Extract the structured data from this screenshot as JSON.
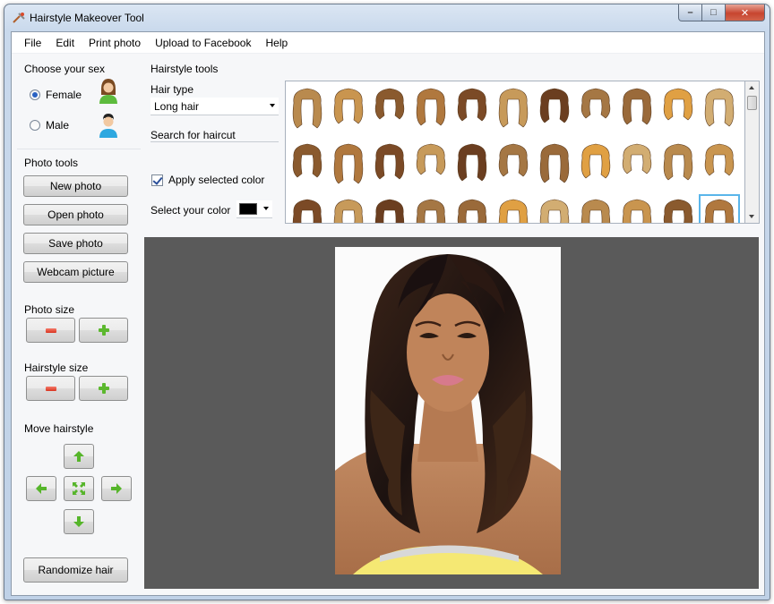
{
  "window": {
    "title": "Hairstyle Makeover Tool",
    "controls": {
      "minimize": "–",
      "maximize": "□",
      "close": "✕"
    }
  },
  "menu": [
    "File",
    "Edit",
    "Print photo",
    "Upload to Facebook",
    "Help"
  ],
  "sex": {
    "heading": "Choose your sex",
    "options": [
      {
        "label": "Female",
        "selected": true,
        "icon": "female-avatar-icon"
      },
      {
        "label": "Male",
        "selected": false,
        "icon": "male-avatar-icon"
      }
    ]
  },
  "photo_tools": {
    "heading": "Photo tools",
    "buttons": [
      "New photo",
      "Open photo",
      "Save photo",
      "Webcam picture"
    ]
  },
  "photo_size": {
    "heading": "Photo size"
  },
  "hairstyle_size": {
    "heading": "Hairstyle size"
  },
  "move_hairstyle": {
    "heading": "Move hairstyle"
  },
  "randomize": {
    "label": "Randomize hair"
  },
  "hairstyle_tools": {
    "heading": "Hairstyle tools",
    "hair_type_label": "Hair type",
    "hair_type_value": "Long hair",
    "search_label": "Search for haircut",
    "apply_color_label": "Apply selected color",
    "apply_color_checked": true,
    "select_color_label": "Select your color",
    "selected_color": "#000000"
  },
  "gallery": {
    "rows": 3,
    "columns": 11,
    "selected_index": 32
  },
  "colors": {
    "canvas_background": "#5a5a5a",
    "minus_red": "#d93420",
    "plus_green": "#5cb82e",
    "selection_blue": "#5ab5ea"
  }
}
